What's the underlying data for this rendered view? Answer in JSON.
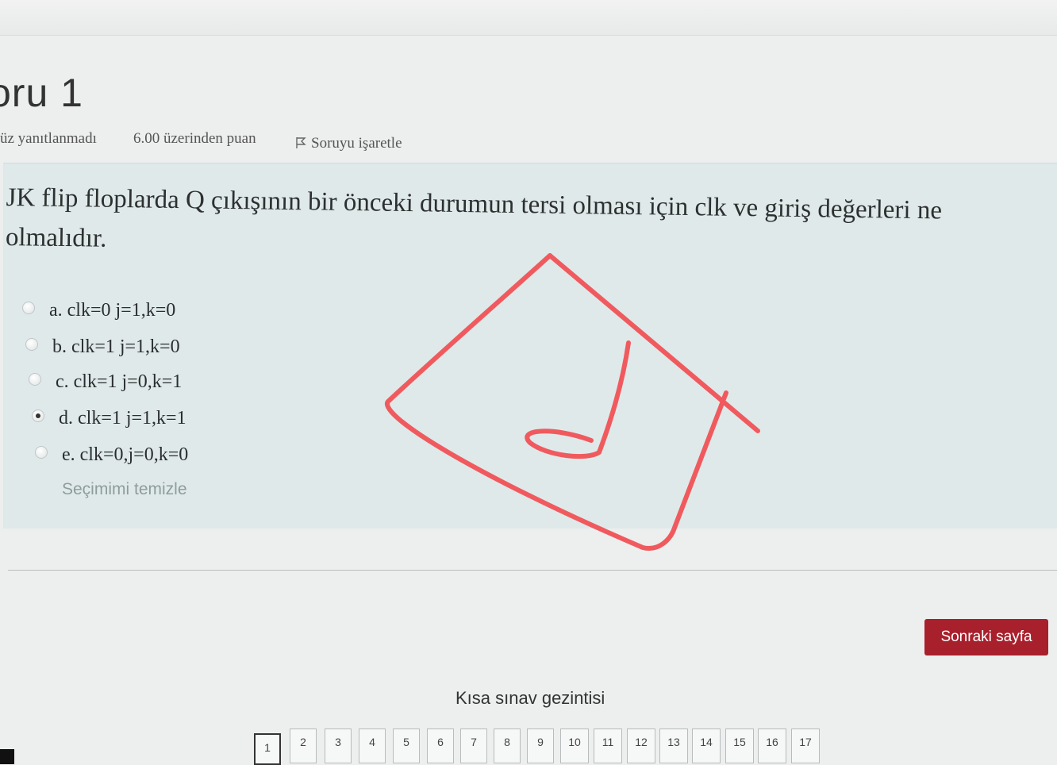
{
  "question": {
    "title": "oru 1",
    "status": "üz yanıtlanmadı",
    "points": "6.00 üzerinden puan",
    "flag_label": "Soruyu işaretle",
    "text": "JK flip floplarda Q çıkışının bir önceki durumun tersi olması için clk ve giriş değerleri ne",
    "text_line2": "olmalıdır.",
    "answers": [
      {
        "label": "a. clk=0 j=1,k=0",
        "selected": false
      },
      {
        "label": "b. clk=1 j=1,k=0",
        "selected": false
      },
      {
        "label": "c. clk=1 j=0,k=1",
        "selected": false
      },
      {
        "label": "d. clk=1 j=1,k=1",
        "selected": true
      },
      {
        "label": "e. clk=0,j=0,k=0",
        "selected": false
      }
    ],
    "clear_choice": "Seçimimi temizle"
  },
  "navigation": {
    "next_page": "Sonraki sayfa",
    "title": "Kısa sınav gezintisi",
    "pages": [
      "1",
      "2",
      "3",
      "4",
      "5",
      "6",
      "7",
      "8",
      "9",
      "10",
      "11",
      "12",
      "13",
      "14",
      "15",
      "16",
      "17"
    ],
    "current_page": "1"
  },
  "colors": {
    "accent": "#a8202c",
    "annotation": "#f05a5e",
    "question_bg": "#dfe9e9"
  },
  "icons": {
    "flag": "flag-icon",
    "annotation": "hand-drawn-checkmark-in-box"
  }
}
